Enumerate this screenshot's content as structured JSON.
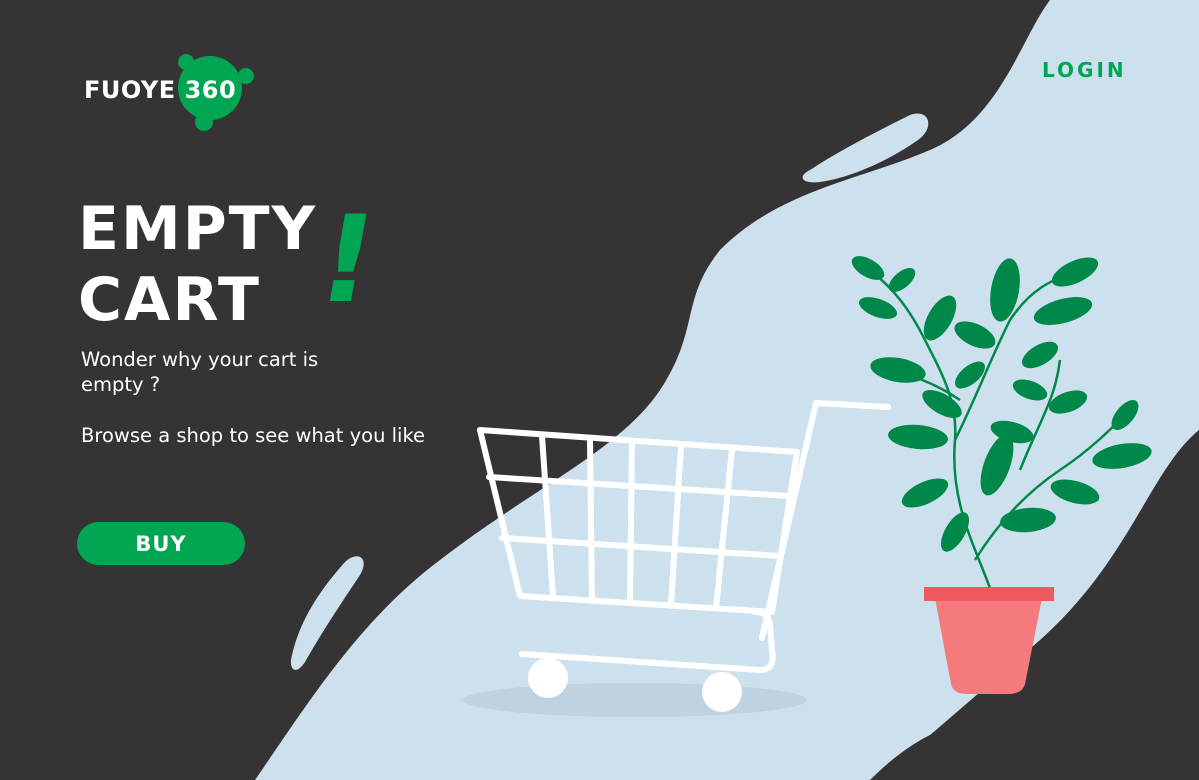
{
  "brand": {
    "name": "FUOYE",
    "number": "360"
  },
  "nav": {
    "login_label": "LOGIN"
  },
  "hero": {
    "title_line1": "EMPTY",
    "title_line2": "CART",
    "title_mark": "!",
    "message_line1": "Wonder why your cart is empty ?",
    "message_line2": "Browse a shop to see what you like",
    "buy_label": "BUY"
  },
  "colors": {
    "background": "#353334",
    "wave": "#cde0ee",
    "accent": "#00a651",
    "leaf": "#00884a",
    "pot": "#f47a7d",
    "pot_rim": "#ef5a5c",
    "cart": "#ffffff"
  },
  "icons": [
    "shopping-cart-icon",
    "potted-plant-icon",
    "logo-dots-icon"
  ]
}
